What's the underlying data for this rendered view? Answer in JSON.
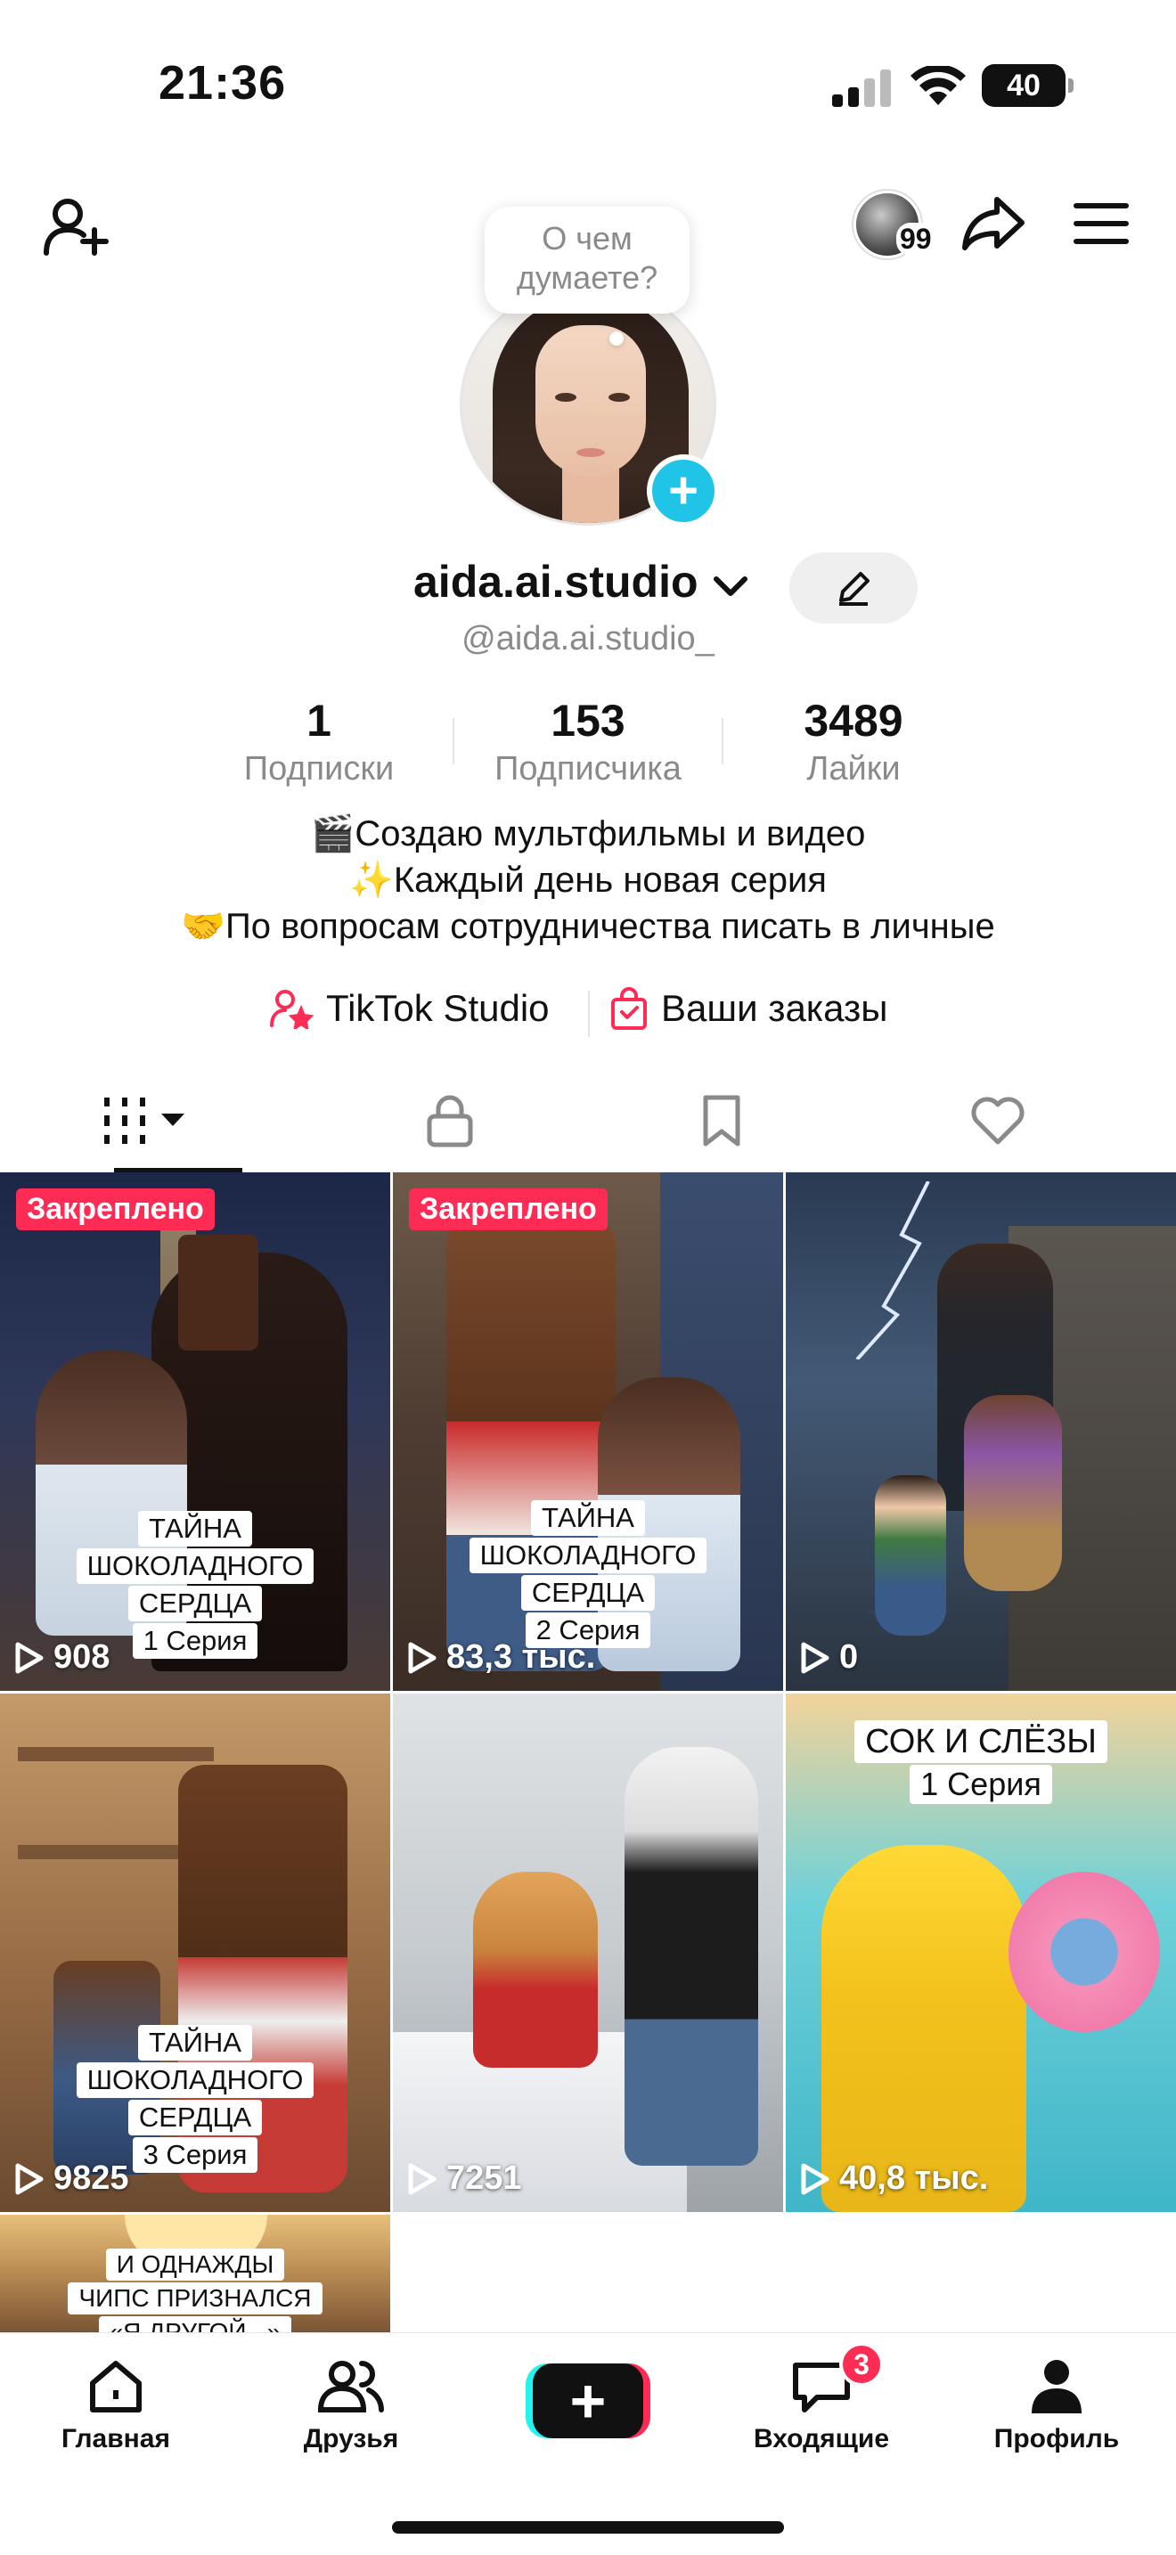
{
  "status_bar": {
    "time": "21:36",
    "battery": "40"
  },
  "header": {
    "stories_count": "99"
  },
  "profile": {
    "bubble_line1": "О чем",
    "bubble_line2": "думаете?",
    "username": "aida.ai.studio",
    "handle": "@aida.ai.studio_"
  },
  "stats": [
    {
      "value": "1",
      "label": "Подписки"
    },
    {
      "value": "153",
      "label": "Подписчика"
    },
    {
      "value": "3489",
      "label": "Лайки"
    }
  ],
  "bio": [
    "🎬Создаю мультфильмы и видео",
    "✨Каждый день новая серия",
    "🤝По вопросам сотрудничества писать в личные"
  ],
  "links": {
    "studio": "TikTok Studio",
    "orders": "Ваши заказы"
  },
  "icons": {
    "add_friend": "person-plus-icon",
    "share": "share-arrow-icon",
    "menu": "hamburger-menu-icon",
    "edit": "pencil-icon",
    "tab_videos": "grid-icon",
    "tab_private": "lock-icon",
    "tab_saved": "bookmark-icon",
    "tab_liked": "heart-icon",
    "views": "play-icon"
  },
  "colors": {
    "accent": "#fe2c55",
    "cyan": "#25f4ee",
    "plus": "#20c4e6"
  },
  "videos": [
    {
      "pinned_label": "Закреплено",
      "views": "908",
      "caption": [
        "ТАЙНА",
        "ШОКОЛАДНОГО",
        "СЕРДЦА",
        "1 Серия"
      ]
    },
    {
      "pinned_label": "Закреплено",
      "views": "83,3 тыс.",
      "caption": [
        "ТАЙНА",
        "ШОКОЛАДНОГО",
        "СЕРДЦА",
        "2 Серия"
      ]
    },
    {
      "views": "0"
    },
    {
      "views": "9825",
      "caption": [
        "ТАЙНА",
        "ШОКОЛАДНОГО",
        "СЕРДЦА",
        "3 Серия"
      ]
    },
    {
      "views": "7251"
    },
    {
      "views": "40,8 тыс.",
      "caption": [
        "СОК И СЛЁЗЫ",
        "1 Серия"
      ]
    },
    {
      "caption": [
        "И ОДНАЖДЫ",
        "ЧИПС ПРИЗНАЛСЯ",
        "«Я ДРУГОЙ...»"
      ]
    }
  ],
  "bottom_nav": [
    {
      "label": "Главная"
    },
    {
      "label": "Друзья"
    },
    {
      "label": ""
    },
    {
      "label": "Входящие",
      "badge": "3"
    },
    {
      "label": "Профиль"
    }
  ]
}
